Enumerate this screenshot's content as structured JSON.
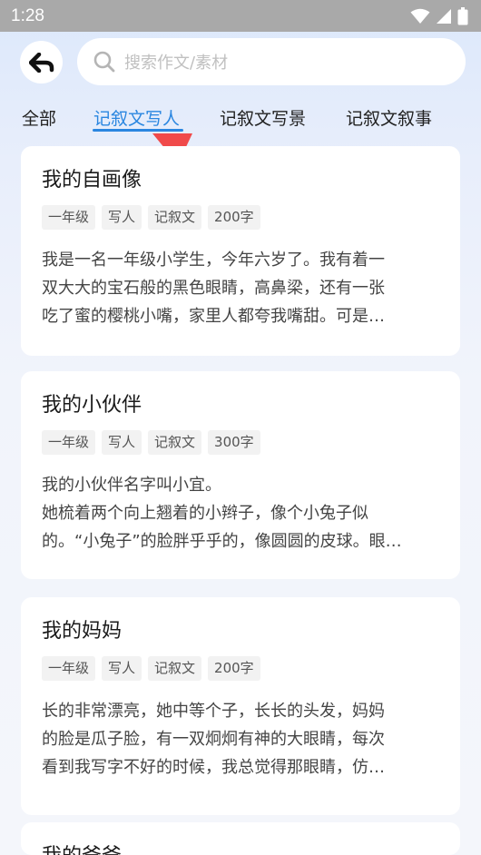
{
  "status": {
    "time": "1:28"
  },
  "search": {
    "placeholder": "搜索作文/素材"
  },
  "tabs": [
    {
      "label": "全部"
    },
    {
      "label": "记叙文写人"
    },
    {
      "label": "记叙文写景"
    },
    {
      "label": "记叙文叙事"
    }
  ],
  "colors": {
    "accent": "#2a86e0",
    "arrow": "#f04a4a"
  },
  "articles": [
    {
      "title": "我的自画像",
      "tags": [
        "一年级",
        "写人",
        "记叙文",
        "200字"
      ],
      "lines": [
        "我是一名一年级小学生，今年六岁了。我有着一",
        "双大大的宝石般的黑色眼睛，高鼻梁，还有一张",
        "吃了蜜的樱桃小嘴，家里人都夸我嘴甜。可是…"
      ]
    },
    {
      "title": "我的小伙伴",
      "tags": [
        "一年级",
        "写人",
        "记叙文",
        "300字"
      ],
      "lines": [
        "我的小伙伴名字叫小宜。",
        "她梳着两个向上翘着的小辫子，像个小兔子似",
        "的。“小兔子”的脸胖乎乎的，像圆圆的皮球。眼…"
      ]
    },
    {
      "title": "我的妈妈",
      "tags": [
        "一年级",
        "写人",
        "记叙文",
        "200字"
      ],
      "lines": [
        "长的非常漂亮，她中等个子，长长的头发，妈妈",
        "的脸是瓜子脸，有一双炯炯有神的大眼睛，每次",
        "看到我写字不好的时候，我总觉得那眼睛，仿…"
      ]
    },
    {
      "title": "我的爸爸",
      "tags": [],
      "lines": []
    }
  ]
}
